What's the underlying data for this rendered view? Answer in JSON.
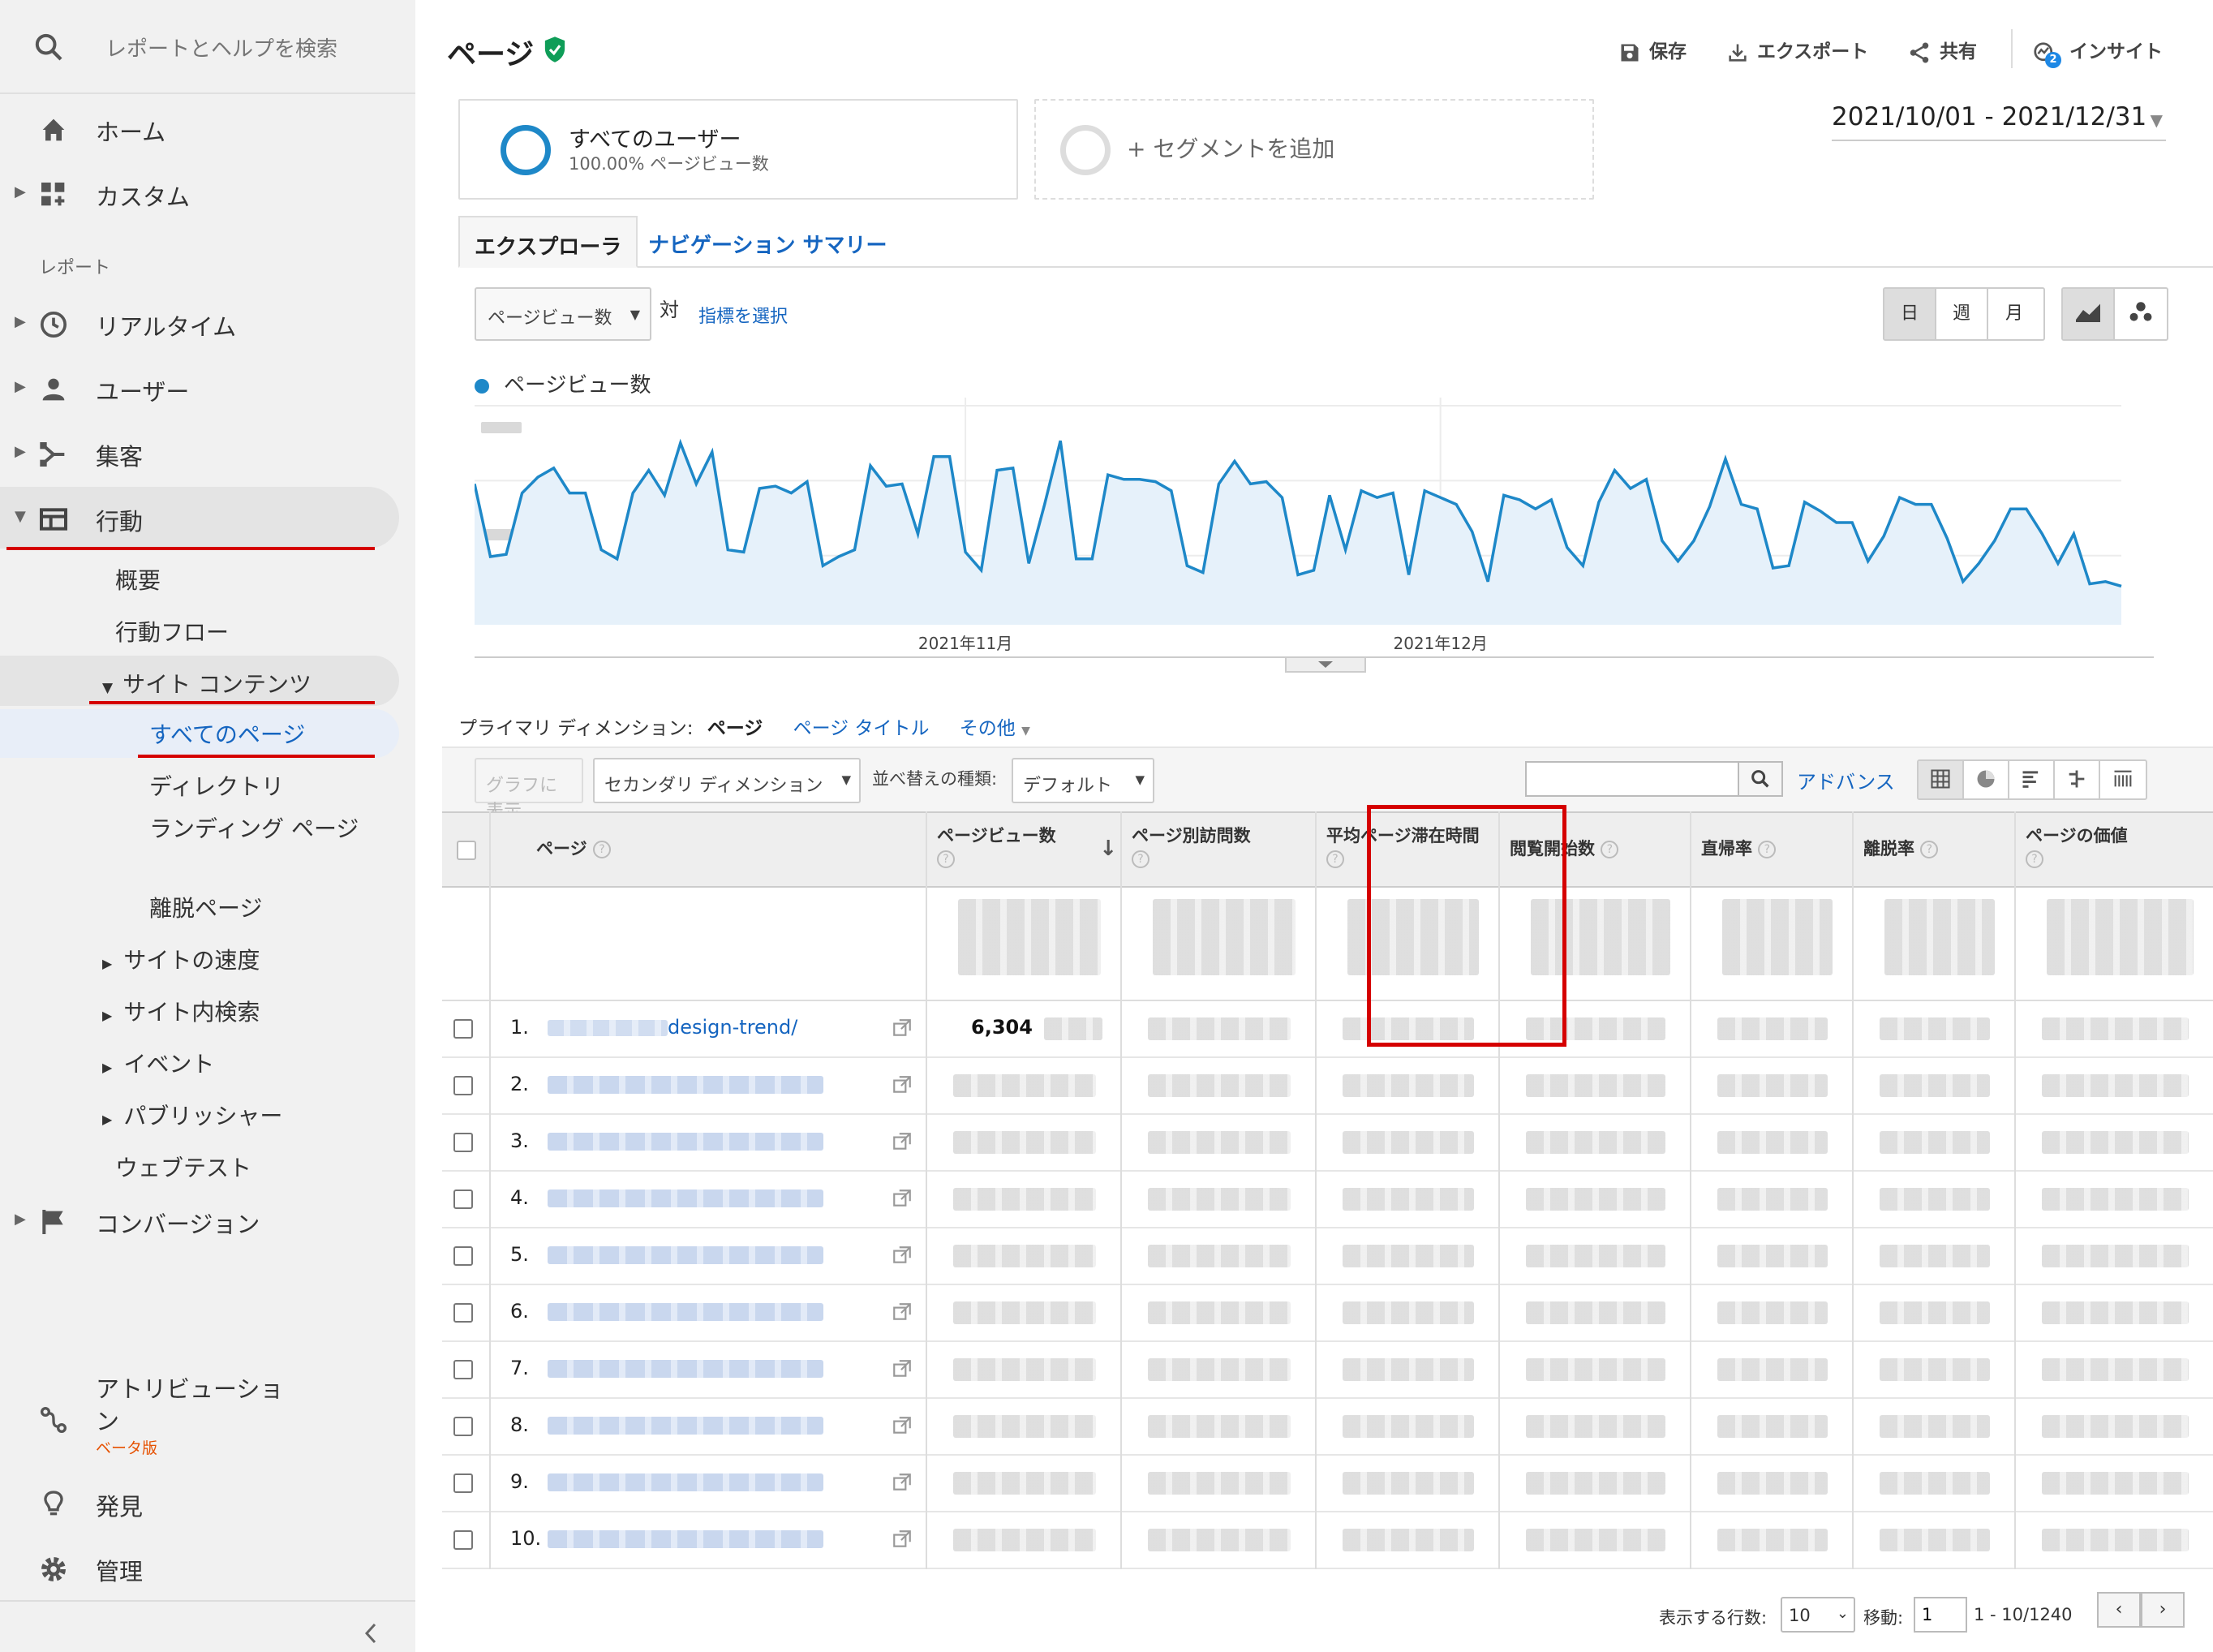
{
  "sidebar": {
    "search_placeholder": "レポートとヘルプを検索",
    "top_items": [
      {
        "label": "ホーム"
      },
      {
        "label": "カスタム"
      }
    ],
    "section_label": "レポート",
    "report_items": [
      {
        "label": "リアルタイム"
      },
      {
        "label": "ユーザー"
      },
      {
        "label": "集客"
      },
      {
        "label": "行動"
      }
    ],
    "behavior_sub": [
      "概要",
      "行動フロー"
    ],
    "site_content": "サイト コンテンツ",
    "site_content_sub": [
      "すべてのページ",
      "ディレクトリ",
      "ランディング ページ",
      "離脱ページ"
    ],
    "behavior_more": [
      "サイトの速度",
      "サイト内検索",
      "イベント",
      "パブリッシャー",
      "ウェブテスト"
    ],
    "conversion": "コンバージョン",
    "attribution": "アトリビューション",
    "beta": "ベータ版",
    "discover": "発見",
    "admin": "管理"
  },
  "header": {
    "title": "ページ",
    "save": "保存",
    "export": "エクスポート",
    "share": "共有",
    "insight": "インサイト",
    "insight_badge": "2"
  },
  "segments": {
    "all_users": "すべてのユーザー",
    "all_users_sub": "100.00% ページビュー数",
    "add_segment": "+ セグメントを追加"
  },
  "date_range": "2021/10/01 - 2021/12/31",
  "tabs": [
    "エクスプローラ",
    "ナビゲーション サマリー"
  ],
  "chart_controls": {
    "metric": "ページビュー数",
    "vs": "対",
    "choose_metric": "指標を選択",
    "period_buttons": [
      "日",
      "週",
      "月"
    ],
    "legend": "ページビュー数"
  },
  "chart_data": {
    "type": "line",
    "series": [
      {
        "name": "ページビュー数",
        "values": [
          62,
          30,
          31,
          58,
          65,
          69,
          58,
          58,
          33,
          29,
          58,
          68,
          57,
          80,
          62,
          76,
          33,
          32,
          60,
          61,
          58,
          63,
          26,
          30,
          33,
          70,
          61,
          62,
          40,
          74,
          74,
          32,
          24,
          68,
          69,
          27,
          53,
          81,
          29,
          29,
          66,
          64,
          64,
          63,
          59,
          26,
          23,
          62,
          72,
          62,
          63,
          56,
          22,
          24,
          57,
          33,
          59,
          56,
          58,
          22,
          59,
          56,
          53,
          41,
          19,
          57,
          55,
          51,
          55,
          34,
          26,
          54,
          68,
          60,
          64,
          37,
          28,
          37,
          52,
          73,
          53,
          51,
          25,
          26,
          54,
          50,
          45,
          45,
          28,
          39,
          56,
          53,
          53,
          38,
          19,
          27,
          37,
          51,
          51,
          40,
          27,
          40,
          18,
          19,
          17
        ]
      }
    ],
    "x_tick_labels": [
      "2021年11月",
      "2021年12月"
    ],
    "color": "#1e88c8"
  },
  "dimension": {
    "label": "プライマリ ディメンション:",
    "selected": "ページ",
    "page_title": "ページ タイトル",
    "other": "その他"
  },
  "table_controls": {
    "plot_rows": "グラフに表示",
    "secondary_dim": "セカンダリ ディメンション",
    "sort_label": "並べ替えの種類:",
    "sort_value": "デフォルト",
    "advanced": "アドバンス"
  },
  "table": {
    "columns": [
      "ページ",
      "ページビュー数",
      "ページ別訪問数",
      "平均ページ滞在時間",
      "閲覧開始数",
      "直帰率",
      "離脱率",
      "ページの価値"
    ],
    "rows": [
      {
        "num": "1.",
        "page": "design-trend/",
        "pageviews": "6,304"
      },
      {
        "num": "2.",
        "page": "",
        "pageviews": ""
      },
      {
        "num": "3.",
        "page": "",
        "pageviews": ""
      },
      {
        "num": "4.",
        "page": "",
        "pageviews": ""
      },
      {
        "num": "5.",
        "page": "",
        "pageviews": ""
      },
      {
        "num": "6.",
        "page": "",
        "pageviews": ""
      },
      {
        "num": "7.",
        "page": "",
        "pageviews": ""
      },
      {
        "num": "8.",
        "page": "",
        "pageviews": ""
      },
      {
        "num": "9.",
        "page": "",
        "pageviews": ""
      },
      {
        "num": "10.",
        "page": "",
        "pageviews": ""
      }
    ]
  },
  "footer": {
    "rows_label": "表示する行数:",
    "rows_value": "10",
    "goto_label": "移動:",
    "goto_value": "1",
    "range": "1 - 10/1240"
  },
  "colors": {
    "accent": "#1e88c8",
    "link": "#1565c0",
    "highlight": "#d50000"
  }
}
